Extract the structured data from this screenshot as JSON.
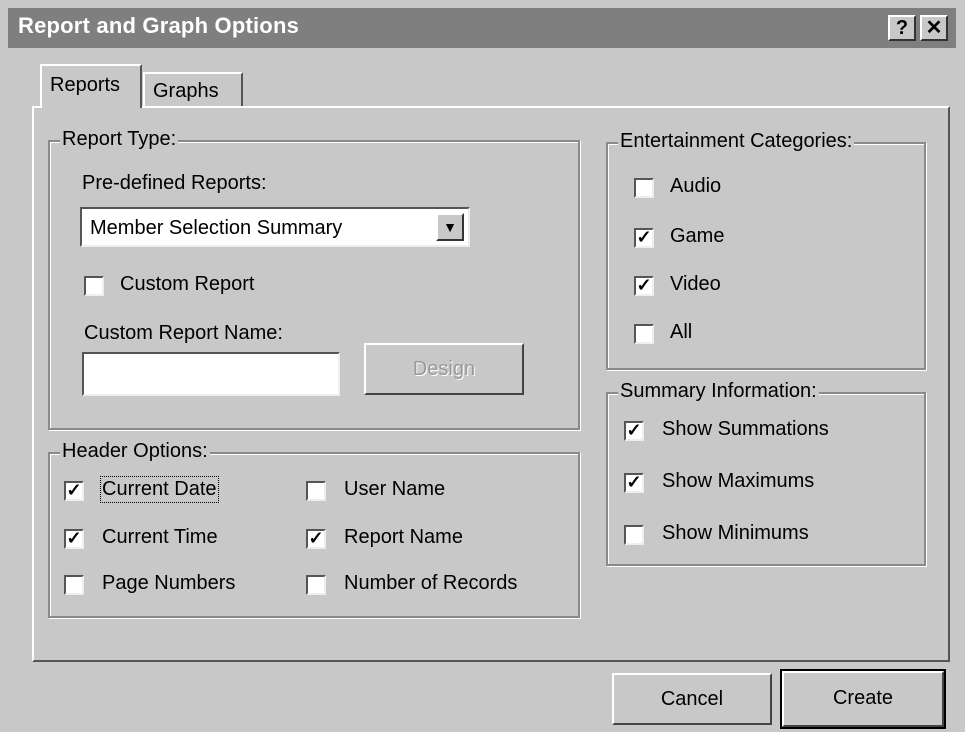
{
  "window": {
    "title": "Report and Graph Options",
    "help_label": "?",
    "close_label": "✕"
  },
  "tabs": [
    {
      "label": "Reports",
      "selected": true
    },
    {
      "label": "Graphs",
      "selected": false
    }
  ],
  "report_type": {
    "legend": "Report Type:",
    "predefined_label": "Pre-defined Reports:",
    "predefined_selected": "Member Selection Summary",
    "dropdown_arrow": "▼",
    "custom_report": {
      "label": "Custom Report",
      "checked": false
    },
    "custom_name_label": "Custom Report Name:",
    "custom_name_value": "",
    "design_label": "Design"
  },
  "header_options": {
    "legend": "Header Options:",
    "items": [
      {
        "label": "Current Date",
        "checked": true
      },
      {
        "label": "Current Time",
        "checked": true
      },
      {
        "label": "Page Numbers",
        "checked": false
      },
      {
        "label": "User Name",
        "checked": false
      },
      {
        "label": "Report Name",
        "checked": true
      },
      {
        "label": "Number of Records",
        "checked": false
      }
    ]
  },
  "entertainment_categories": {
    "legend": "Entertainment Categories:",
    "items": [
      {
        "label": "Audio",
        "checked": false
      },
      {
        "label": "Game",
        "checked": true
      },
      {
        "label": "Video",
        "checked": true
      },
      {
        "label": "All",
        "checked": false
      }
    ]
  },
  "summary_information": {
    "legend": "Summary Information:",
    "items": [
      {
        "label": "Show Summations",
        "checked": true
      },
      {
        "label": "Show Maximums",
        "checked": true
      },
      {
        "label": "Show Minimums",
        "checked": false
      }
    ]
  },
  "buttons": {
    "cancel": "Cancel",
    "create": "Create"
  },
  "check_glyph": "✓"
}
